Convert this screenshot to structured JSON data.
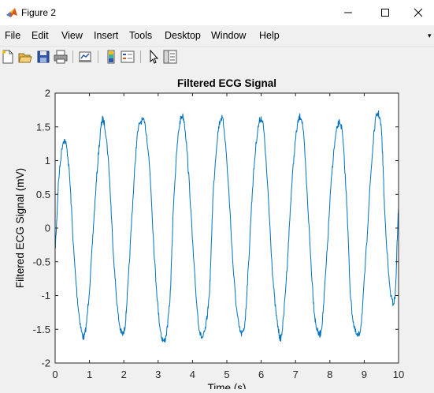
{
  "window": {
    "title": "Figure 2",
    "icon": "matlab-logo-icon",
    "controls": [
      "minimize-icon",
      "maximize-icon",
      "close-icon"
    ]
  },
  "menu": {
    "items": [
      "File",
      "Edit",
      "View",
      "Insert",
      "Tools",
      "Desktop",
      "Window",
      "Help"
    ]
  },
  "toolbar": {
    "icons": [
      "new-figure-icon",
      "open-file-icon",
      "save-icon",
      "print-icon",
      "link-plot-icon",
      "insert-colorbar-icon",
      "insert-legend-icon",
      "pointer-icon",
      "property-editor-icon"
    ]
  },
  "colors": {
    "line": "#0072bd",
    "axes_background": "#ffffff",
    "figure_background": "#f0f0f0"
  },
  "chart_data": {
    "type": "line",
    "title": "Filtered ECG Signal",
    "xlabel": "Time (s)",
    "ylabel": "Filtered ECG Signal (mV)",
    "xlim": [
      0,
      10
    ],
    "ylim": [
      -2,
      2
    ],
    "xticks": [
      0,
      1,
      2,
      3,
      4,
      5,
      6,
      7,
      8,
      9,
      10
    ],
    "yticks": [
      2,
      1.5,
      1,
      0.5,
      0,
      -0.5,
      -1,
      -1.5,
      -2
    ],
    "grid": false,
    "series": [
      {
        "color": "#0072bd",
        "x": [
          0,
          0.1,
          0.25,
          0.4,
          0.55,
          0.7,
          0.85,
          1.0,
          1.15,
          1.3,
          1.4,
          1.55,
          1.7,
          1.85,
          2.0,
          2.1,
          2.25,
          2.4,
          2.6,
          2.75,
          2.9,
          3.05,
          3.2,
          3.35,
          3.45,
          3.6,
          3.75,
          3.9,
          4.05,
          4.2,
          4.35,
          4.5,
          4.6,
          4.75,
          4.9,
          5.05,
          5.2,
          5.35,
          5.5,
          5.6,
          5.75,
          5.9,
          6.05,
          6.2,
          6.35,
          6.5,
          6.6,
          6.75,
          6.9,
          7.05,
          7.2,
          7.35,
          7.5,
          7.6,
          7.75,
          7.9,
          8.05,
          8.2,
          8.35,
          8.5,
          8.6,
          8.75,
          8.9,
          9.05,
          9.2,
          9.35,
          9.5,
          9.6,
          9.75,
          9.9,
          10.0
        ],
        "y": [
          -0.3,
          0.7,
          1.3,
          0.9,
          -0.4,
          -1.3,
          -1.6,
          -0.9,
          0.3,
          1.3,
          1.6,
          1.0,
          -0.4,
          -1.35,
          -1.55,
          -1.0,
          0.3,
          1.4,
          1.55,
          0.9,
          -0.5,
          -1.45,
          -1.65,
          -1.0,
          0.4,
          1.45,
          1.6,
          0.7,
          -0.6,
          -1.5,
          -1.55,
          -0.9,
          0.5,
          1.45,
          1.55,
          0.6,
          -0.7,
          -1.45,
          -1.5,
          -0.8,
          0.6,
          1.45,
          1.55,
          0.5,
          -0.8,
          -1.5,
          -1.55,
          -0.6,
          0.7,
          1.5,
          1.55,
          0.4,
          -0.9,
          -1.45,
          -1.5,
          -0.5,
          0.75,
          1.45,
          1.45,
          0.3,
          -1.0,
          -1.55,
          -1.45,
          -0.4,
          0.85,
          1.65,
          1.45,
          0.2,
          -0.9,
          -1.0,
          0.3
        ]
      }
    ]
  }
}
